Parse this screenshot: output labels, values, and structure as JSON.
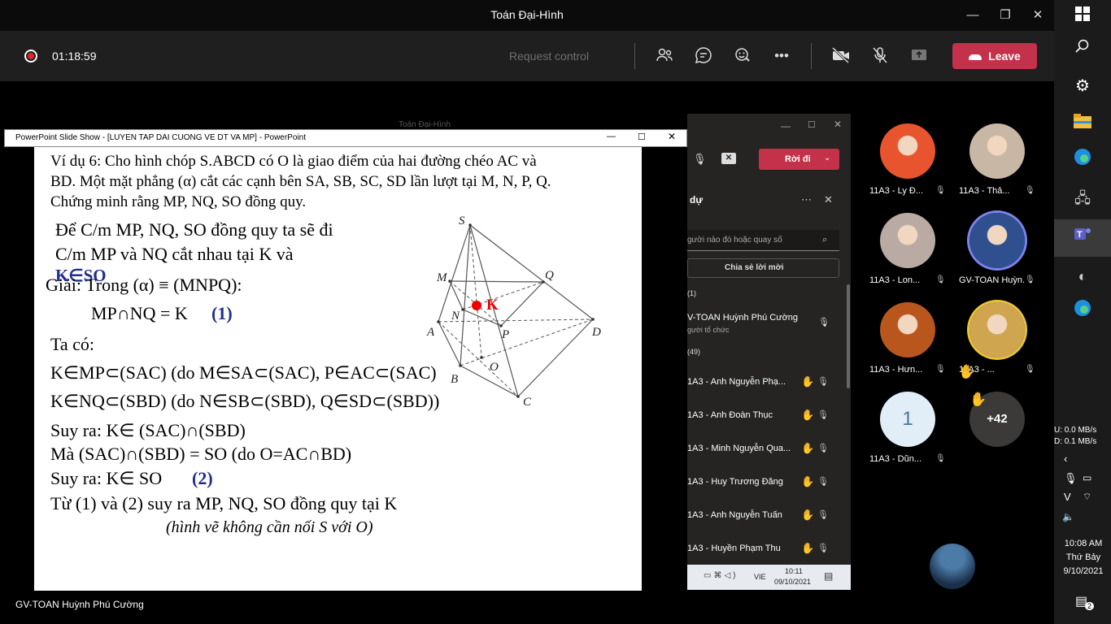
{
  "window": {
    "title": "Toán Đại-Hình"
  },
  "meeting": {
    "timer": "01:18:59",
    "request_control": "Request control",
    "leave": "Leave"
  },
  "ppt": {
    "window_title": "PowerPoint Slide Show - [LUYEN TAP DAI CUONG VE DT VA MP] - PowerPoint",
    "behind_title": "Toán Đại-Hình"
  },
  "slide": {
    "lines": [
      "Ví dụ 6: Cho hình chóp S.ABCD có O là giao điểm của hai đường chéo AC và",
      "BD. Một mặt phẳng (α) cắt các cạnh bên SA, SB, SC, SD lần lượt tại M, N, P, Q.",
      "Chứng minh rằng MP, NQ, SO đồng quy.",
      "Để C/m MP, NQ, SO đồng quy ta sẽ đi",
      "C/m MP và NQ cắt nhau tại K và",
      "K∈SO",
      "Giải: Trong (α) ≡ (MNPQ):",
      "MP∩NQ = K",
      "(1)",
      "Ta có:",
      "K∈MP⊂(SAC) (do M∈SA⊂(SAC), P∈AC⊂(SAC)",
      "K∈NQ⊂(SBD) (do N∈SB⊂(SBD), Q∈SD⊂(SBD))",
      "Suy ra:  K∈ (SAC)∩(SBD)",
      "Mà          (SAC)∩(SBD) = SO (do O=AC∩BD)",
      "Suy ra:  K∈ SO",
      "(2)",
      "Từ (1) và (2) suy ra MP, NQ, SO đồng quy tại K",
      "(hình vẽ không cần nối S với O)"
    ],
    "figure_labels": {
      "S": "S",
      "M": "M",
      "Q": "Q",
      "K": "K",
      "N": "N",
      "A": "A",
      "P": "P",
      "D": "D",
      "O": "O",
      "B": "B",
      "C": "C"
    }
  },
  "presenter": "GV-TOAN Huỳnh Phú Cường",
  "inner_teams": {
    "leave": "Rời đi",
    "panel_title": "dự",
    "search": "gười nào đó hoặc quay số",
    "share": "Chia sẻ lời mời",
    "section1": "(1)",
    "host": "V-TOAN Huỳnh Phú Cường",
    "host_role": "gười tổ chức",
    "section2": "(49)",
    "members": [
      "1A3 - Anh Nguyễn Phạ...",
      "1A3 - Anh Đoàn Thục",
      "1A3 - Minh Nguyễn Qua...",
      "1A3 - Huy Trương Đăng",
      "1A3 - Anh Nguyễn Tuấn",
      "1A3 - Huyền Phạm Thu"
    ],
    "tray_lang": "VIE",
    "tray_time": "10:11",
    "tray_date": "09/10/2021"
  },
  "gallery": [
    {
      "name": "11A3 - Ly Đ...",
      "color": "#e8542e"
    },
    {
      "name": "11A3 - Thả...",
      "color": "#c9b7a6"
    },
    {
      "name": "11A3 - Lon...",
      "color": "#b9aba3"
    },
    {
      "name": "GV-TOAN Huỳn...",
      "color": "#2f4f8f"
    },
    {
      "name": "11A3 - Hưn...",
      "color": "#b8561d"
    },
    {
      "name": "11A3 - ...",
      "color": "#cfa64f"
    },
    {
      "name": "11A3 - Dũn...",
      "initial": "1"
    },
    {
      "name": "",
      "more": "+42"
    }
  ],
  "taskbar": {
    "net_up": "U:      0.0 MB/s",
    "net_down": "D:      0.1 MB/s",
    "time": "10:08 AM",
    "day": "Thứ Bảy",
    "date": "9/10/2021",
    "notif": "2"
  }
}
